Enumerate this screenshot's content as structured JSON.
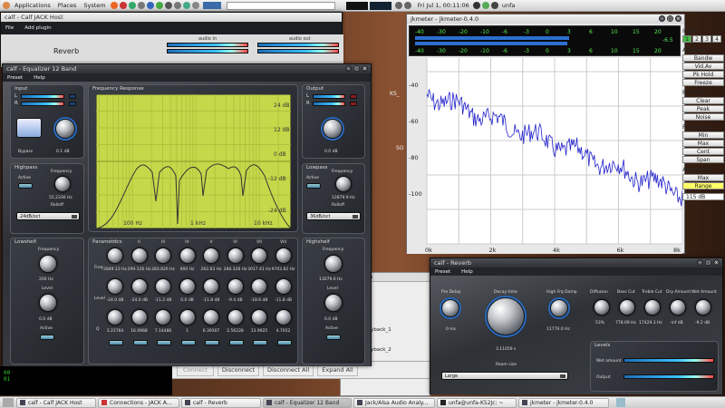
{
  "top_panel": {
    "menus": [
      "Applications",
      "Places",
      "System"
    ],
    "clock": "Fri Jul 1, 00:11:06",
    "user": "unfa"
  },
  "taskbar": {
    "items": [
      "calf - Calf JACK Host",
      "Connections - JACK A...",
      "calf - Reverb",
      "calf - Equalizer 12 Band",
      "Jack/Alsa Audio Analy...",
      "unfa@unfa-K52Jc: ~",
      "jkmeter - jkmeter-0.4.0"
    ]
  },
  "host": {
    "title": "calf - Calf JACK Host",
    "menu": [
      "File",
      "Add plugin"
    ],
    "plugin": "Reverb",
    "audio_in": "audio in",
    "audio_out": "audio out"
  },
  "eq": {
    "title": "calf - Equalizer 12 Band",
    "menu": [
      "Preset",
      "Help"
    ],
    "input": "Input",
    "output": "Output",
    "freq_response": "Frequency Response",
    "L": "L",
    "R": "R",
    "bypass": "Bypass",
    "input_gain": "0.1 dB",
    "output_gain": "0.0 dB",
    "highpass": "Highpass",
    "lowpass": "Lowpass",
    "active": "Active",
    "frequency": "Frequency",
    "rolloff": "Rolloff",
    "hp_freq": "55.2336 Hz",
    "lp_freq": "12879.9 Hz",
    "hp_rolloff": "24dB/oct",
    "lp_rolloff": "36dB/oct",
    "db_labels": [
      "24 dB",
      "12 dB",
      "0 dB",
      "-12 dB",
      "-24 dB"
    ],
    "hz_labels": [
      "100 Hz",
      "1 kHz",
      "10 kHz"
    ],
    "lowshelf": "Lowshelf",
    "highshelf": "Highshelf",
    "level": "Level",
    "ls_freq": "200 Hz",
    "ls_level": "0.0 dB",
    "hs_freq": "13079.6 Hz",
    "hs_level": "0.0 dB",
    "parametrics": "Parametrics",
    "row_freq": "Freq",
    "row_level": "Level",
    "row_q": "Q",
    "bands": [
      "I",
      "II",
      "III",
      "IV",
      "V",
      "VI",
      "VII",
      "VIII"
    ],
    "band_freqs": [
      "2849.13 Hz",
      "299.126 Hz",
      "283.826 Hz",
      "900 Hz",
      "262.63 Hz",
      "288.328 Hz",
      "3017.41 Hz",
      "9703.82 Hz"
    ],
    "band_levels": [
      "-24.0 dB",
      "-24.0 dB",
      "-11.2 dB",
      "0.0 dB",
      "-11.8 dB",
      "-9.4 dB",
      "-18.6 dB",
      "-11.8 dB"
    ],
    "band_qs": [
      "3.21764",
      "16.0968",
      "7.14486",
      "1",
      "6.39307",
      "2.56228",
      "13.9925",
      "4.7052"
    ]
  },
  "jkmeter": {
    "title": "jkmeter - jkmeter-0.4.0",
    "scale": [
      "-40",
      "-30",
      "-20",
      "-10",
      "-6",
      "-3",
      "0",
      "3",
      "6",
      "10",
      "15",
      "20"
    ],
    "readout": "-6.5",
    "input_label": "Input",
    "input_buttons": [
      "1",
      "2",
      "3",
      "4"
    ],
    "analyser_label": "Analyser",
    "analyser_buttons": [
      "Bandw",
      "Vid.Av",
      "Pk Hold",
      "Freeze"
    ],
    "markers_label": "Markers",
    "markers_buttons": [
      "Clear",
      "Peak",
      "Noise"
    ],
    "frequency_label": "Frequency",
    "frequency_buttons": [
      "Min",
      "Max",
      "Cent",
      "Span"
    ],
    "amplitude_label": "Amplitude",
    "amplitude_buttons": [
      "Max",
      "Range"
    ],
    "range_value": "115 dB",
    "y_ticks": [
      "-40",
      "-60",
      "-80",
      "-100"
    ],
    "x_ticks": [
      "0k",
      "2k",
      "4k",
      "6k",
      "8k"
    ]
  },
  "connections": {
    "tab": "/ Input Ports",
    "ports": [
      "_playback_1",
      "_playback_2"
    ],
    "connect": "Connect",
    "disconnect": "Disconnect",
    "disconnect_all": "Disconnect All",
    "expand_all": "Expand All",
    "side": [
      "KS_",
      "SO"
    ]
  },
  "terminal": {
    "lines": [
      "00",
      "01"
    ]
  },
  "reverb": {
    "title": "calf - Reverb",
    "menu": [
      "Preset",
      "Help"
    ],
    "pre_delay": "Pre Delay",
    "pre_delay_val": "0 ms",
    "decay": "Decay time",
    "decay_val": "3.11059 s",
    "hp_damp": "High Frq Damp",
    "hp_damp_val": "11776.0 Hz",
    "room": "Room size",
    "room_val": "Large",
    "diffusion": "Diffusion",
    "diffusion_val": "53%",
    "basscut": "Bass Cut",
    "basscut_val": "778.09 Hz",
    "treblecut": "Treble Cut",
    "treblecut_val": "17429.3 Hz",
    "dry": "Dry Amount",
    "dry_val": "-inf dB",
    "wet": "Wet Amount",
    "wet_val": "-9.2 dB",
    "levels": "Levels",
    "wet_amount": "Wet amount",
    "output": "Output"
  }
}
